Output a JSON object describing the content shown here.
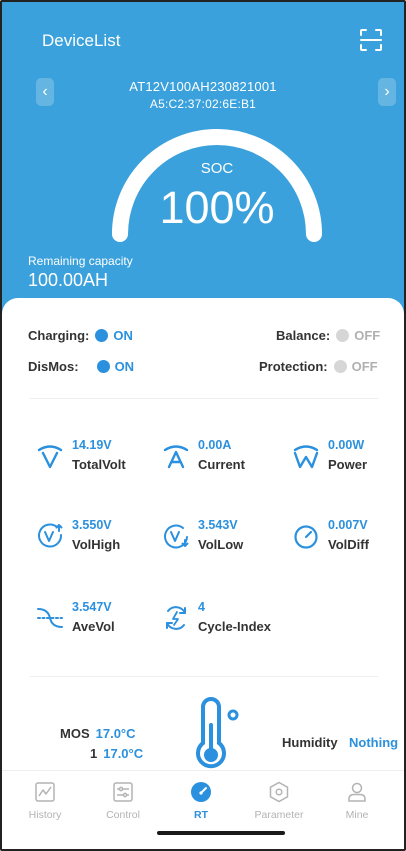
{
  "header": {
    "title": "DeviceList",
    "scan_icon": "scan-icon",
    "prev_icon": "chevron-left-icon",
    "next_icon": "chevron-right-icon",
    "device_name": "AT12V100AH230821001",
    "device_mac": "A5:C2:37:02:6E:B1",
    "soc_label": "SOC",
    "soc_value": "100%",
    "soc_fraction": 1.0,
    "remaining_label": "Remaining capacity",
    "remaining_value": "100.00AH",
    "colors": {
      "background": "#3aa1dc",
      "text": "#ffffff"
    }
  },
  "states": {
    "charging": {
      "label": "Charging:",
      "status": "ON"
    },
    "balance": {
      "label": "Balance:",
      "status": "OFF"
    },
    "dismos": {
      "label": "DisMos:",
      "status": "ON"
    },
    "protection": {
      "label": "Protection:",
      "status": "OFF"
    }
  },
  "metrics": {
    "total_volt": {
      "value": "14.19V",
      "name": "TotalVolt",
      "icon": "voltage-v-icon"
    },
    "current": {
      "value": "0.00A",
      "name": "Current",
      "icon": "current-a-icon"
    },
    "power": {
      "value": "0.00W",
      "name": "Power",
      "icon": "power-w-icon"
    },
    "vol_high": {
      "value": "3.550V",
      "name": "VolHigh",
      "icon": "voltage-high-icon"
    },
    "vol_low": {
      "value": "3.543V",
      "name": "VolLow",
      "icon": "voltage-low-icon"
    },
    "vol_diff": {
      "value": "0.007V",
      "name": "VolDiff",
      "icon": "gauge-icon"
    },
    "ave_vol": {
      "value": "3.547V",
      "name": "AveVol",
      "icon": "average-wave-icon"
    },
    "cycle_index": {
      "value": "4",
      "name": "Cycle-Index",
      "icon": "cycle-bolt-icon"
    }
  },
  "temperature": {
    "rows": [
      {
        "label": "MOS",
        "value": "17.0°C"
      },
      {
        "label": "1",
        "value": "17.0°C"
      }
    ],
    "icon": "thermometer-icon",
    "humidity_label": "Humidity",
    "humidity_value": "Nothing"
  },
  "tabs": [
    {
      "label": "History",
      "icon": "history-chart-icon",
      "active": false
    },
    {
      "label": "Control",
      "icon": "control-sliders-icon",
      "active": false
    },
    {
      "label": "RT",
      "icon": "realtime-gauge-icon",
      "active": true
    },
    {
      "label": "Parameter",
      "icon": "parameter-hexagon-icon",
      "active": false
    },
    {
      "label": "Mine",
      "icon": "user-icon",
      "active": false
    }
  ],
  "colors": {
    "accent": "#2b90dd",
    "inactive": "#b3b3b3",
    "off_dot": "#d6d6d6"
  }
}
